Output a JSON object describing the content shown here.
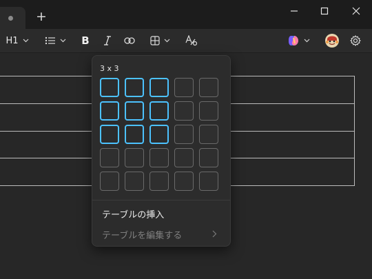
{
  "titlebar": {
    "new_tab_symbol": "+"
  },
  "toolbar": {
    "heading_label": "H1",
    "bold_symbol": "B"
  },
  "table_flyout": {
    "size_label": "3 x 3",
    "grid_rows": 5,
    "grid_cols": 5,
    "selected_rows": 3,
    "selected_cols": 3,
    "insert_label": "テーブルの挿入",
    "edit_label": "テーブルを編集する"
  },
  "colors": {
    "accent": "#4cc2ff",
    "background": "#272727",
    "toolbar": "#2b2b2b",
    "flyout": "#2c2c2c"
  },
  "icons": [
    "more-tab-icon",
    "new-tab-icon",
    "minimize-icon",
    "maximize-icon",
    "close-icon",
    "list-icon",
    "italic-icon",
    "link-icon",
    "table-icon",
    "spellcheck-icon",
    "copilot-icon",
    "avatar",
    "settings-gear-icon",
    "chevron-down-icon",
    "chevron-right-icon"
  ]
}
